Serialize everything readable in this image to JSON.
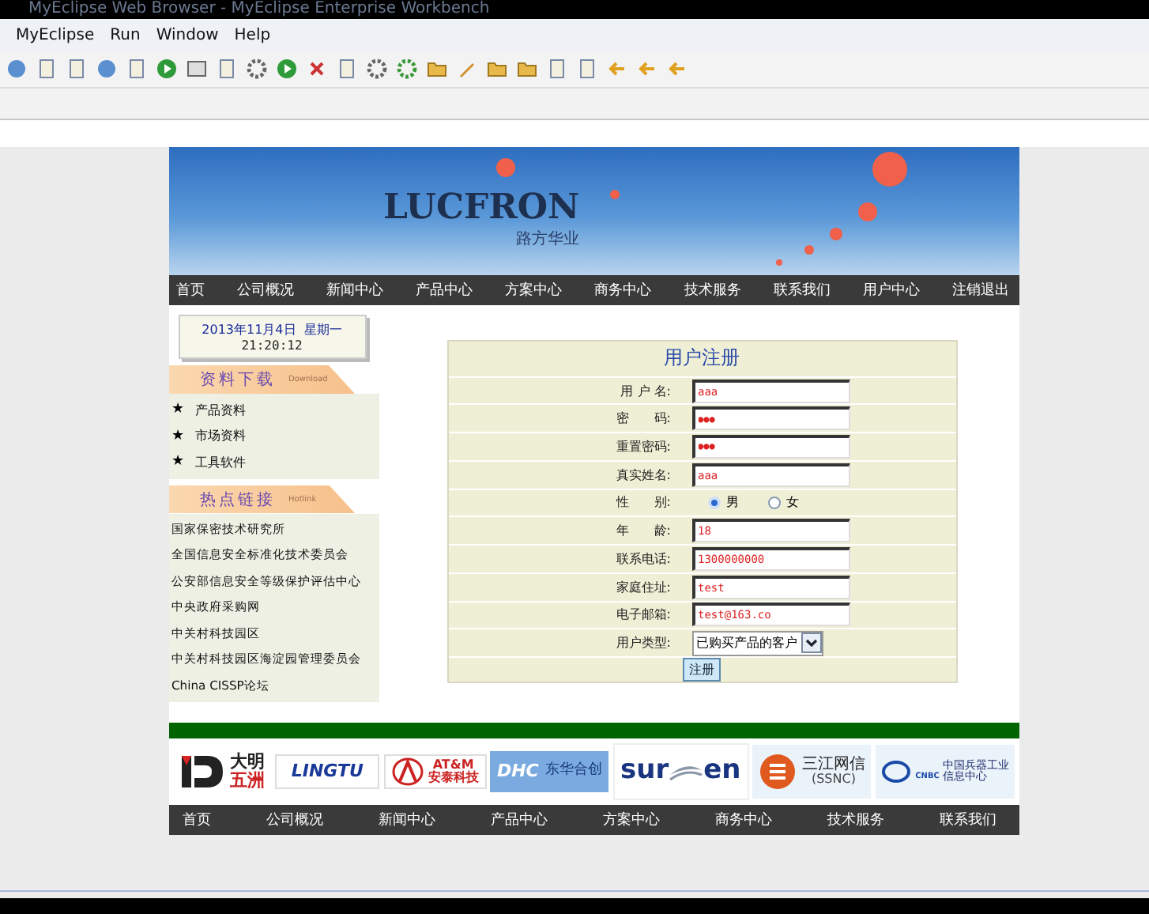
{
  "window": {
    "title": "MyEclipse Web Browser - MyEclipse Enterprise Workbench"
  },
  "menu": [
    "MyEclipse",
    "Run",
    "Window",
    "Help"
  ],
  "banner": {
    "logo": "LUCFRON",
    "subtitle": "路方华业"
  },
  "top_nav": [
    "首页",
    "公司概况",
    "新闻中心",
    "产品中心",
    "方案中心",
    "商务中心",
    "技术服务",
    "联系我们",
    "用户中心",
    "注销退出"
  ],
  "clock": {
    "date": "2013年11月4日  星期一",
    "time": "21:20:12"
  },
  "downloads": {
    "title": "资料下载",
    "subtitle": "Download",
    "items": [
      "产品资料",
      "市场资料",
      "工具软件"
    ],
    "bullet": "★"
  },
  "links": {
    "title": "热点链接",
    "subtitle": "Hotlink",
    "items": [
      "国家保密技术研究所",
      "全国信息安全标准化技术委员会",
      "公安部信息安全等级保护评估中心",
      "中央政府采购网",
      "中关村科技园区",
      "中关村科技园区海淀园管理委员会",
      "China CISSP论坛"
    ]
  },
  "form": {
    "title": "用户注册",
    "fields": [
      {
        "kind": "text",
        "label": "用 户 名:",
        "value": "aaa"
      },
      {
        "kind": "password",
        "label": "密　　码:",
        "value": "●●●"
      },
      {
        "kind": "password",
        "label": "重置密码:",
        "value": "●●●"
      },
      {
        "kind": "text",
        "label": "真实姓名:",
        "value": "aaa"
      },
      {
        "kind": "radio",
        "label": "性　　别:",
        "options": [
          {
            "label": "男",
            "selected": true
          },
          {
            "label": "女",
            "selected": false
          }
        ]
      },
      {
        "kind": "text",
        "label": "年　　龄:",
        "value": "18"
      },
      {
        "kind": "text",
        "label": "联系电话:",
        "value": "1300000000"
      },
      {
        "kind": "text",
        "label": "家庭住址:",
        "value": "test"
      },
      {
        "kind": "text",
        "label": "电子邮箱:",
        "value": "test@163.co"
      },
      {
        "kind": "select",
        "label": "用户类型:",
        "value": "已购买产品的客户"
      }
    ],
    "submit": "注册"
  },
  "partners": [
    {
      "kind": "dm",
      "lines": [
        "大明",
        "五洲"
      ]
    },
    {
      "kind": "plain",
      "lines": [
        "LINGTU"
      ]
    },
    {
      "kind": "atm",
      "lines": [
        "AT&M",
        "安泰科技"
      ]
    },
    {
      "kind": "dhc",
      "lines": [
        "DHC",
        "东华合创"
      ]
    },
    {
      "kind": "swoosh",
      "lines": [
        "sur",
        "en"
      ]
    },
    {
      "kind": "ssnc",
      "lines": [
        "三江网信",
        "(SSNC)"
      ]
    },
    {
      "kind": "cnbc",
      "lines": [
        "CNBC",
        "中国兵器工业",
        "信息中心"
      ]
    }
  ],
  "bottom_nav": [
    "首页",
    "公司概况",
    "新闻中心",
    "产品中心",
    "方案中心",
    "商务中心",
    "技术服务",
    "联系我们"
  ]
}
